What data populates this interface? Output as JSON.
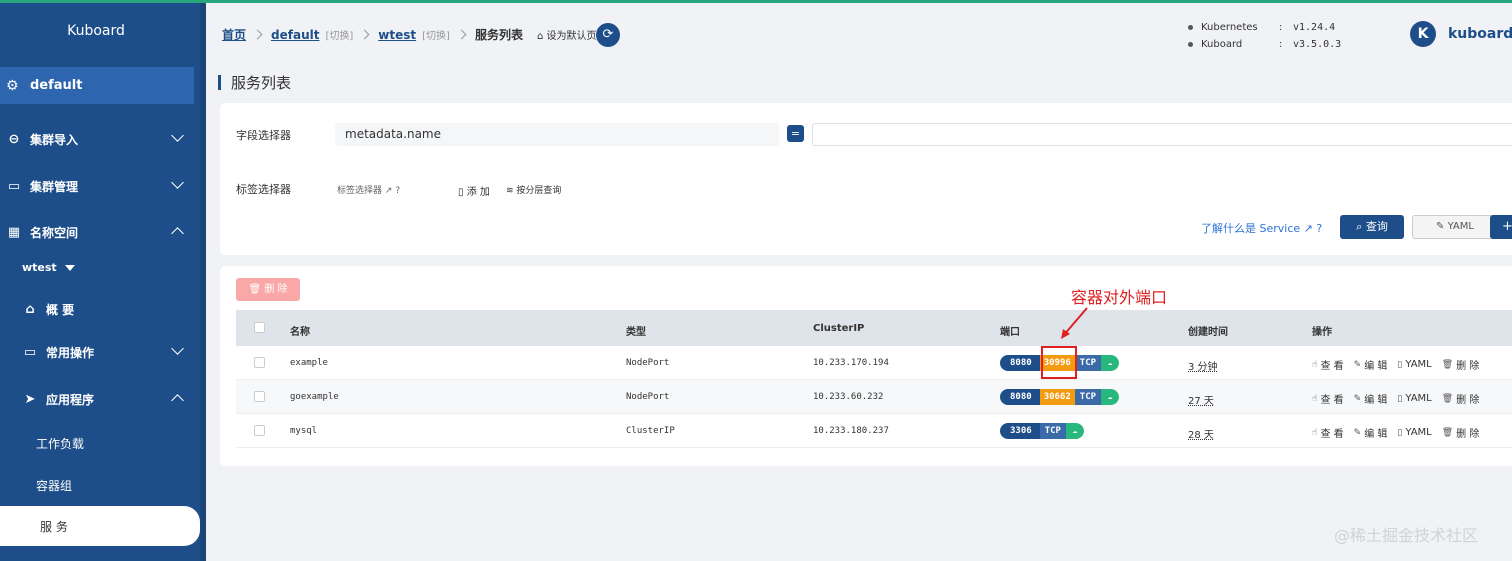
{
  "sidebar": {
    "brand": "Kuboard",
    "current_ns": "default",
    "items": [
      {
        "label": "集群导入",
        "icon": "link-icon"
      },
      {
        "label": "集群管理",
        "icon": "folder-icon"
      },
      {
        "label": "名称空间",
        "icon": "grid-icon"
      }
    ],
    "namespace": "wtest",
    "overview": "概 要",
    "common_ops": "常用操作",
    "apps": "应用程序",
    "workloads": "工作负载",
    "pods": "容器组",
    "services": "服 务"
  },
  "breadcrumb": {
    "home": "首页",
    "cluster": "default",
    "switch1": "[切换]",
    "namespace": "wtest",
    "switch2": "[切换]",
    "current": "服务列表",
    "set_default": "设为默认页"
  },
  "versions": [
    {
      "name": "Kubernetes",
      "sep": ":",
      "value": "v1.24.4"
    },
    {
      "name": "Kuboard",
      "sep": ":",
      "value": "v3.5.0.3"
    }
  ],
  "user": {
    "avatar": "K",
    "name": "kuboard-a"
  },
  "page_title": "服务列表",
  "filter": {
    "field_selector_label": "字段选择器",
    "field_selector_value": "metadata.name",
    "eq": "=",
    "label_selector_label": "标签选择器",
    "label_selector_link": "标签选择器",
    "add": "添 加",
    "layer_query": "按分层查询",
    "help": "了解什么是 Service",
    "query": "查询",
    "yaml": "YAML",
    "plus": "+"
  },
  "table": {
    "delete": "删 除",
    "headers": [
      "名称",
      "类型",
      "ClusterIP",
      "端口",
      "创建时间",
      "操作"
    ],
    "rows": [
      {
        "name": "example",
        "type": "NodePort",
        "ip": "10.233.170.194",
        "port": "8080",
        "nodeport": "30996",
        "proto": "TCP",
        "age": "3 分钟"
      },
      {
        "name": "goexample",
        "type": "NodePort",
        "ip": "10.233.60.232",
        "port": "8080",
        "nodeport": "30662",
        "proto": "TCP",
        "age": "27 天"
      },
      {
        "name": "mysql",
        "type": "ClusterIP",
        "ip": "10.233.180.237",
        "port": "3306",
        "nodeport": "",
        "proto": "TCP",
        "age": "28 天"
      }
    ],
    "ops": {
      "view": "查 看",
      "edit": "编 辑",
      "yaml": "YAML",
      "del": "删 除"
    }
  },
  "annotation": "容器对外端口",
  "watermark": "@稀土掘金技术社区",
  "colors": {
    "primary": "#1d4e89",
    "nodeport": "#f39c12",
    "tcp": "#3b6aa8",
    "ok": "#28b87e",
    "annotation": "#e02020"
  }
}
